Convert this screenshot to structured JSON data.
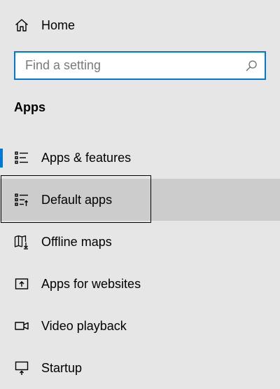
{
  "home": {
    "label": "Home",
    "icon": "home-icon"
  },
  "search": {
    "placeholder": "Find a setting",
    "value": "",
    "icon": "search-icon",
    "border_color": "#0078d7"
  },
  "section": {
    "title": "Apps"
  },
  "nav_items": [
    {
      "label": "Apps & features",
      "icon": "apps-features-icon",
      "selected": true
    },
    {
      "label": "Default apps",
      "icon": "default-apps-icon",
      "hovered": true
    },
    {
      "label": "Offline maps",
      "icon": "offline-maps-icon"
    },
    {
      "label": "Apps for websites",
      "icon": "apps-for-websites-icon"
    },
    {
      "label": "Video playback",
      "icon": "video-playback-icon"
    },
    {
      "label": "Startup",
      "icon": "startup-icon"
    }
  ],
  "colors": {
    "accent": "#0078d7",
    "background": "#e6e6e6",
    "hover": "#cccccc"
  }
}
